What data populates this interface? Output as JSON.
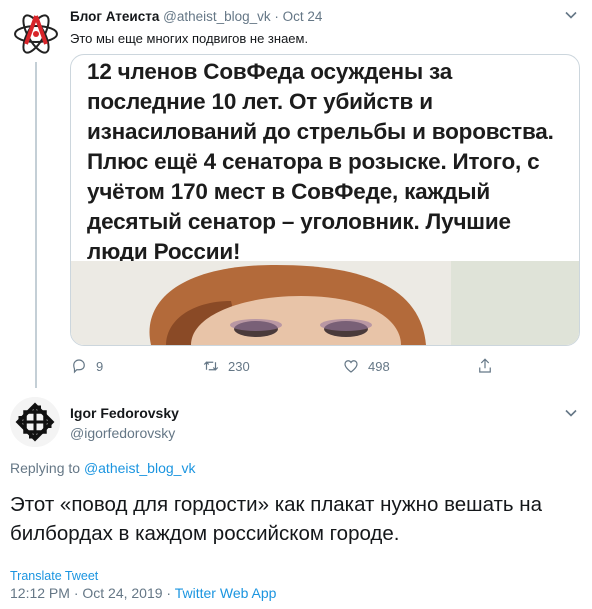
{
  "parent_tweet": {
    "author_name": "Блог Атеиста",
    "handle": "@atheist_blog_vk",
    "separator": "·",
    "date": "Oct 24",
    "text": "Это мы еще многих подвигов не знаем.",
    "card_text": "12 членов СовФеда осуждены за последние 10 лет. От убийств и изнасилований до стрельбы и воровства. Плюс ещё 4 сенатора в розыске. Итого, с учётом 170 мест в СовФеде, каждый десятый сенатор – уголовник. Лучшие люди России!",
    "replies": "9",
    "retweets": "230",
    "likes": "498"
  },
  "reply_tweet": {
    "author_name": "Igor Fedorovsky",
    "handle": "@igorfedorovsky",
    "replying_label": "Replying to",
    "replying_to": "@atheist_blog_vk",
    "text": "Этот «повод для гордости» как плакат нужно вешать на билбордах в каждом российском городе.",
    "translate_label": "Translate Tweet",
    "timestamp": "12:12 PM · Oct 24, 2019 ·",
    "source": "Twitter Web App"
  },
  "colors": {
    "accent": "#1b95e0",
    "muted": "#657786",
    "text": "#14171a",
    "logo_red": "#d8242a"
  }
}
